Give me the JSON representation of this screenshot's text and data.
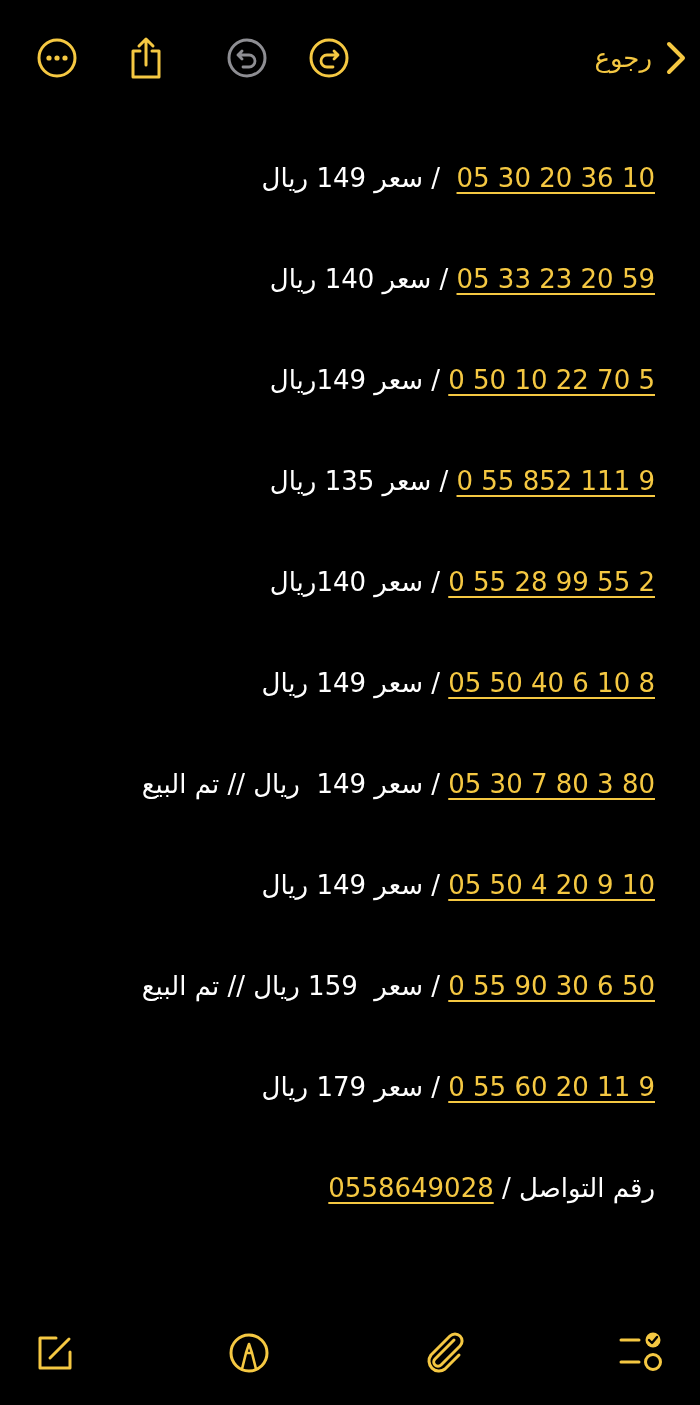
{
  "top_bar": {
    "back": {
      "label": "رجوع"
    },
    "undo": {
      "disabled": true
    },
    "redo": {
      "disabled": false
    }
  },
  "note": {
    "lines": [
      {
        "kind": "listing",
        "phone": "05 30 20 36 10",
        "text": "  / سعر 149 ريال"
      },
      {
        "kind": "listing",
        "phone": "05 33 23 20 59",
        "text": " / سعر 140 ريال"
      },
      {
        "kind": "listing",
        "phone": "0 50 10 22 70 5",
        "text": " / سعر 149ريال"
      },
      {
        "kind": "listing",
        "phone": "0 55 852 111 9",
        "text": " / سعر 135 ريال"
      },
      {
        "kind": "listing",
        "phone": "0 55 28 99 55 2",
        "text": " / سعر 140ريال"
      },
      {
        "kind": "listing",
        "phone": "05 50 40 6 10 8",
        "text": " / سعر 149 ريال"
      },
      {
        "kind": "listing",
        "phone": "05 30 7 80 3 80",
        "text": " / سعر 149  ريال // تم البيع"
      },
      {
        "kind": "listing",
        "phone": "05 50 4 20 9 10",
        "text": " / سعر 149 ريال"
      },
      {
        "kind": "listing",
        "phone": "0 55 90 30 6 50",
        "text": " / سعر  159 ريال // تم البيع"
      },
      {
        "kind": "listing",
        "phone": "0 55 60 20 11 9",
        "text": " / سعر 179 ريال"
      },
      {
        "kind": "contact",
        "phone": "0558649028",
        "text": "رقم التواصل / "
      }
    ]
  }
}
